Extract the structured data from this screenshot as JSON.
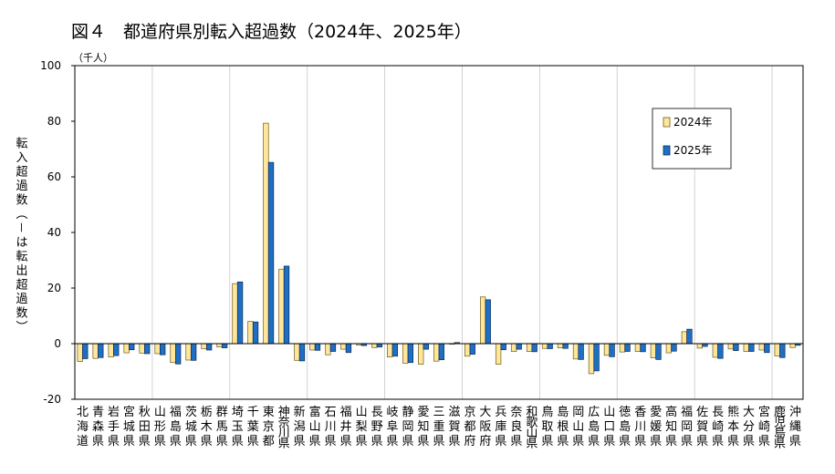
{
  "chart_data": {
    "type": "bar",
    "title": "図４　都道府県別転入超過数（2024年、2025年）",
    "unit": "（千人）",
    "xlabel": "",
    "ylabel": "転入超過数（－は転出超過数）",
    "ylim": [
      -20,
      100
    ],
    "yticks": [
      100,
      80,
      60,
      40,
      20,
      0,
      -20
    ],
    "grid": "vertical lines every 5 categories",
    "legend": "top-right",
    "categories": [
      "北海道",
      "青森県",
      "岩手県",
      "宮城県",
      "秋田県",
      "山形県",
      "福島県",
      "茨城県",
      "栃木県",
      "群馬県",
      "埼玉県",
      "千葉県",
      "東京都",
      "神奈川県",
      "新潟県",
      "富山県",
      "石川県",
      "福井県",
      "山梨県",
      "長野県",
      "岐阜県",
      "静岡県",
      "愛知県",
      "三重県",
      "滋賀県",
      "京都府",
      "大阪府",
      "兵庫県",
      "奈良県",
      "和歌山県",
      "鳥取県",
      "島根県",
      "岡山県",
      "広島県",
      "山口県",
      "徳島県",
      "香川県",
      "愛媛県",
      "高知県",
      "福岡県",
      "佐賀県",
      "長崎県",
      "熊本県",
      "大分県",
      "宮崎県",
      "鹿児島県",
      "沖縄県"
    ],
    "series": [
      {
        "name": "2024年",
        "color": "#FFE699",
        "stroke": "#6B5A1E",
        "values": [
          -6.4,
          -5.3,
          -4.8,
          -3.3,
          -3.4,
          -3.6,
          -6.8,
          -5.9,
          -1.8,
          -1.2,
          21.6,
          8.0,
          79.3,
          26.8,
          -6.0,
          -2.3,
          -4.0,
          -2.0,
          -0.5,
          -1.4,
          -4.8,
          -7.0,
          -7.4,
          -6.3,
          -0.2,
          -4.5,
          16.8,
          -7.4,
          -2.8,
          -2.8,
          -1.7,
          -1.5,
          -5.5,
          -10.8,
          -4.2,
          -3.0,
          -2.8,
          -5.1,
          -3.3,
          4.3,
          -1.6,
          -4.9,
          -1.9,
          -2.8,
          -2.3,
          -4.4,
          -1.4
        ]
      },
      {
        "name": "2025年",
        "color": "#1F6FC4",
        "stroke": "#0B2A55",
        "values": [
          -5.4,
          -5.0,
          -4.3,
          -2.2,
          -3.6,
          -4.0,
          -7.3,
          -6.0,
          -2.3,
          -1.5,
          22.2,
          7.8,
          65.2,
          27.9,
          -6.2,
          -2.4,
          -2.8,
          -3.2,
          -0.7,
          -1.2,
          -4.5,
          -6.8,
          -2.0,
          -5.8,
          0.4,
          -3.8,
          15.8,
          -2.2,
          -2.0,
          -2.9,
          -1.8,
          -1.7,
          -5.7,
          -9.8,
          -4.7,
          -2.8,
          -2.9,
          -5.7,
          -2.7,
          5.2,
          -1.0,
          -5.3,
          -2.5,
          -2.8,
          -3.2,
          -5.0,
          -0.6
        ]
      }
    ]
  }
}
